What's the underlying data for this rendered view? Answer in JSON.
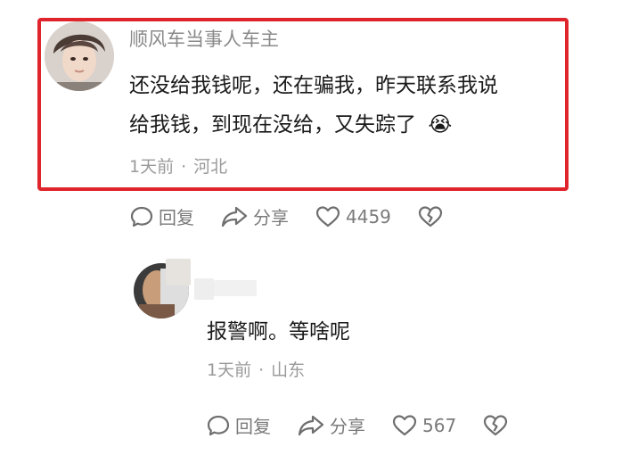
{
  "comments": [
    {
      "username": "顺风车当事人车主",
      "text_line1": "还没给我钱呢，还在骗我，昨天联系我说",
      "text_line2": "给我钱，到现在没给，又失踪了",
      "emoji": "😭",
      "time": "1天前",
      "location": "河北",
      "reply_label": "回复",
      "share_label": "分享",
      "likes": "4459"
    },
    {
      "username": "",
      "text": "报警啊。等啥呢",
      "time": "1天前",
      "location": "山东",
      "reply_label": "回复",
      "share_label": "分享",
      "likes": "567"
    }
  ],
  "colors": {
    "highlight": "#e0242b",
    "text_primary": "#1a1a1a",
    "text_secondary": "#9a9a9a",
    "icon": "#6f6f6f"
  },
  "icons": [
    "comment-icon",
    "share-icon",
    "heart-icon",
    "broken-heart-icon"
  ]
}
